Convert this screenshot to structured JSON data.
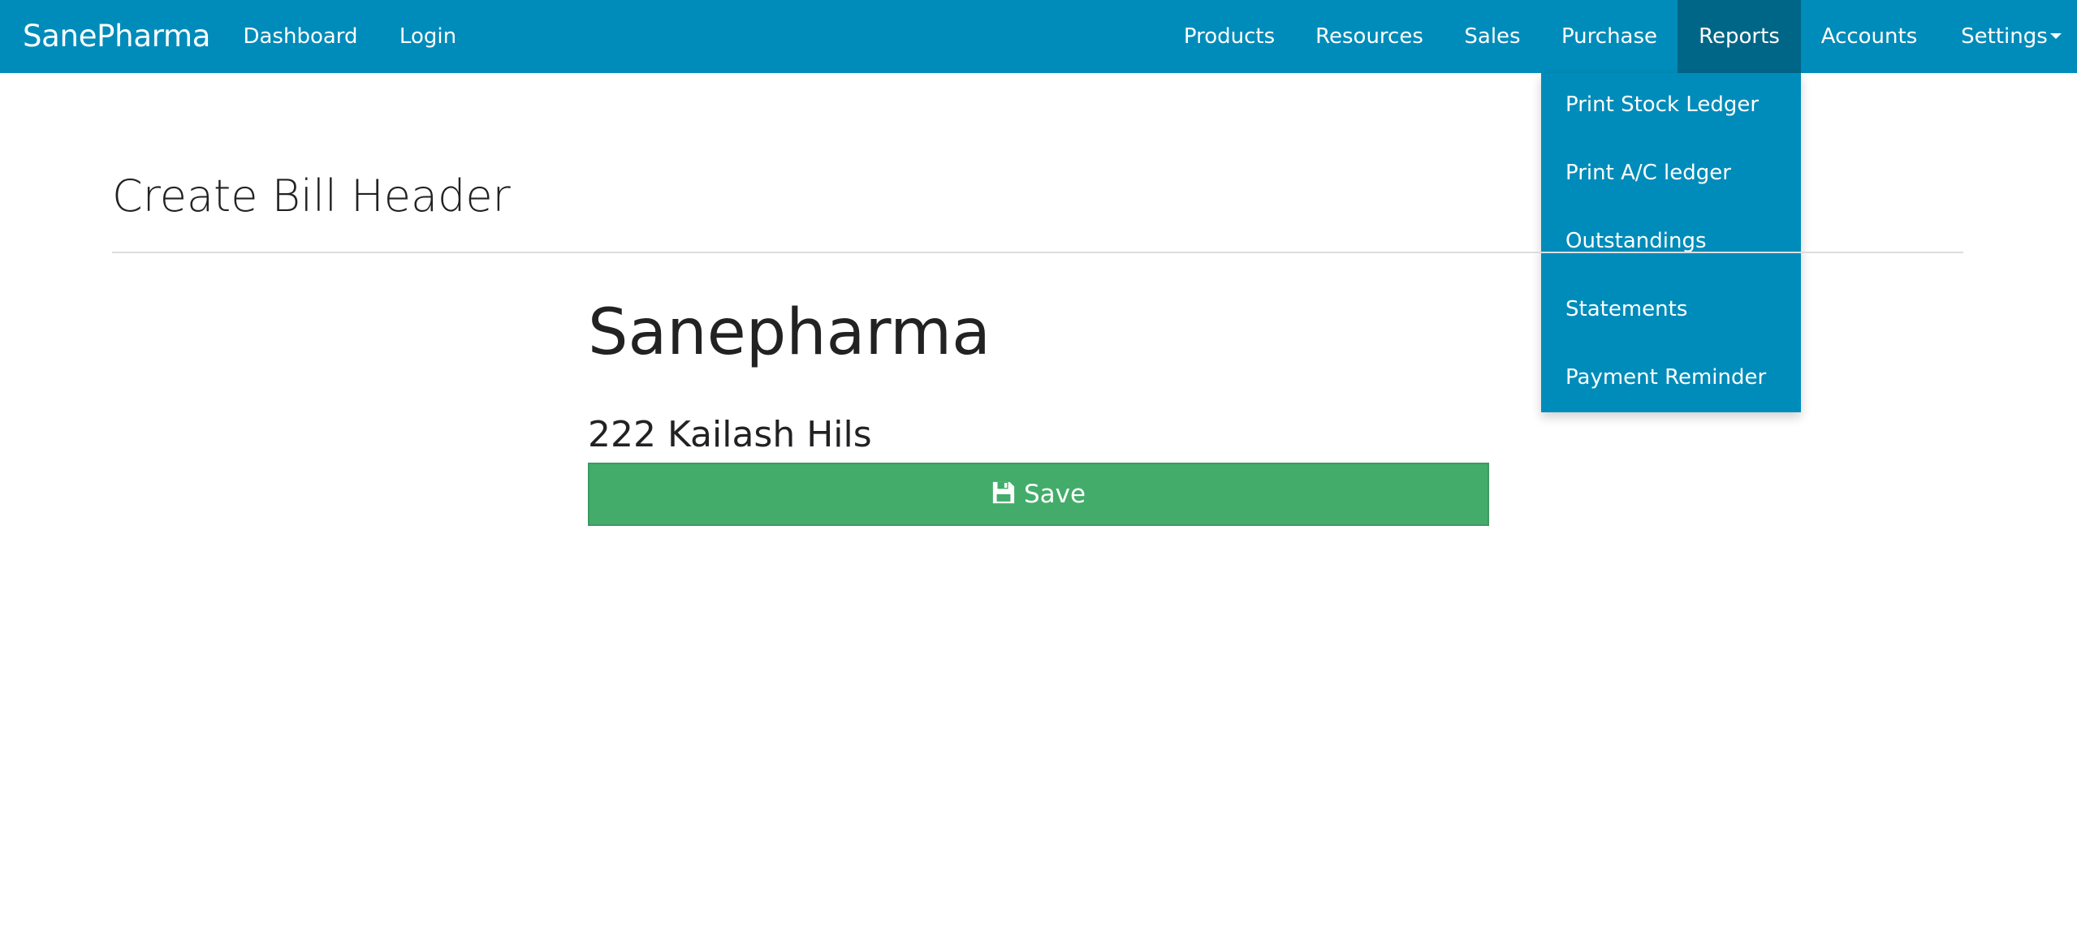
{
  "navbar": {
    "brand": "SanePharma",
    "left_items": [
      {
        "label": "Dashboard"
      },
      {
        "label": "Login"
      }
    ],
    "right_items": [
      {
        "label": "Products"
      },
      {
        "label": "Resources"
      },
      {
        "label": "Sales"
      },
      {
        "label": "Purchase"
      },
      {
        "label": "Reports",
        "active": true
      },
      {
        "label": "Accounts"
      },
      {
        "label": "Settings"
      }
    ],
    "background_color": "#008cba",
    "active_color": "#006687"
  },
  "reports_menu": {
    "items": [
      {
        "label": "Print Stock Ledger"
      },
      {
        "label": "Print A/C ledger"
      },
      {
        "label": "Outstandings"
      },
      {
        "label": "Statements"
      },
      {
        "label": "Payment Reminder"
      }
    ]
  },
  "page": {
    "title": "Create Bill Header",
    "company_name": "Sanepharma",
    "address": "222 Kailash Hils",
    "save_label": "Save",
    "save_icon": "floppy-disk-icon",
    "save_color": "#43ac6a"
  }
}
